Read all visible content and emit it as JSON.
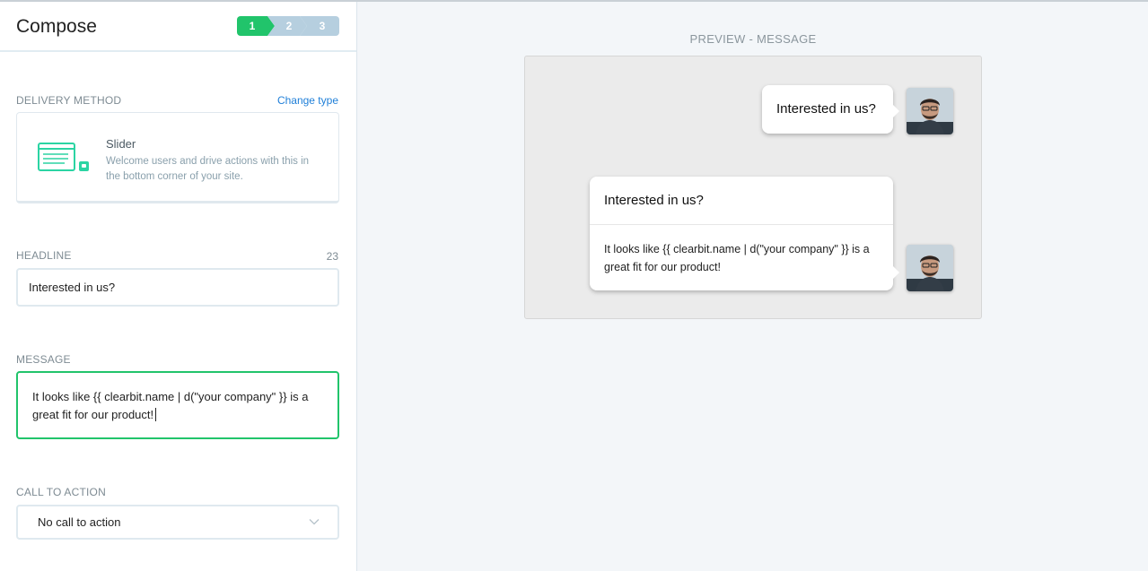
{
  "header": {
    "title": "Compose",
    "steps": [
      "1",
      "2",
      "3"
    ]
  },
  "delivery": {
    "label": "DELIVERY METHOD",
    "change_link": "Change type",
    "type_title": "Slider",
    "type_description": "Welcome users and drive actions with this in the bottom corner of your site."
  },
  "headline": {
    "label": "HEADLINE",
    "count": "23",
    "value": "Interested in us?"
  },
  "message": {
    "label": "MESSAGE",
    "value": "It looks like {{ clearbit.name | d(\"your company\" }} is a great fit for our product!"
  },
  "cta": {
    "label": "CALL TO ACTION",
    "selected": "No call to action"
  },
  "preview": {
    "label": "PREVIEW - MESSAGE",
    "small_bubble_text": "Interested in us?",
    "big_bubble_headline": "Interested in us?",
    "big_bubble_body": "It looks like {{ clearbit.name | d(\"your company\" }} is a great fit for our product!"
  },
  "colors": {
    "accent_green": "#21c46b",
    "link_blue": "#1f7fd8",
    "step_inactive": "#b6cfdf"
  }
}
